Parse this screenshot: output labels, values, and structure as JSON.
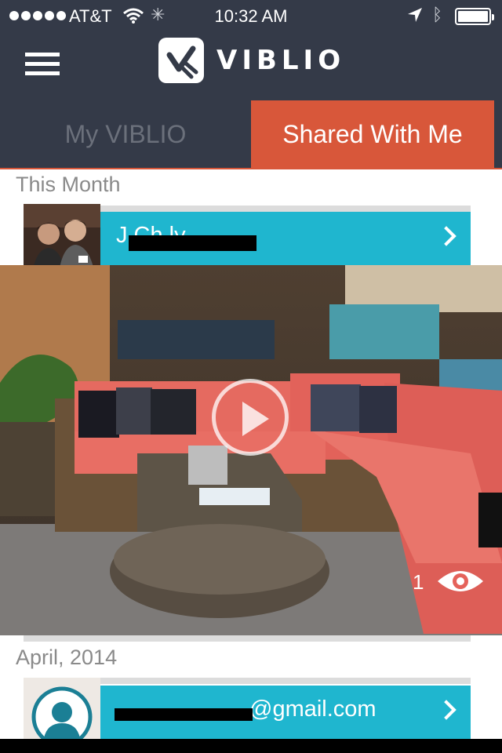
{
  "status_bar": {
    "carrier": "AT&T",
    "time": "10:32 AM"
  },
  "header": {
    "menu_icon": "hamburger-menu-icon",
    "logo_text": "VIBLIO"
  },
  "tabs": [
    {
      "label": "My VIBLIO",
      "active": false
    },
    {
      "label": "Shared With Me",
      "active": true
    }
  ],
  "feed": {
    "sections": [
      {
        "label": "This Month",
        "items": [
          {
            "name_visible": "J      Ch      ly",
            "view_count": "1"
          }
        ]
      },
      {
        "label": "April, 2014",
        "items": [
          {
            "email_visible": "@gmail.com"
          }
        ]
      }
    ]
  },
  "colors": {
    "header_bg": "#343a48",
    "accent_orange": "#d8573a",
    "row_blue": "#1fb6cf",
    "inactive_tab_text": "#6b707b",
    "section_label": "#8a8a8a"
  },
  "icons": {
    "play": "play-circle-icon",
    "views": "eye-icon",
    "chevron": "chevron-right-icon",
    "default_avatar": "person-silhouette-icon"
  }
}
